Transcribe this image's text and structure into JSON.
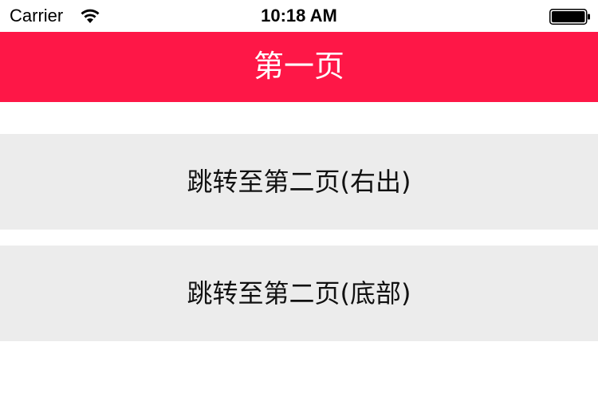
{
  "status_bar": {
    "carrier": "Carrier",
    "time": "10:18 AM",
    "wifi_icon": "wifi-icon",
    "battery_icon": "battery-icon"
  },
  "nav": {
    "title": "第一页",
    "color": "#fe1747"
  },
  "buttons": [
    {
      "label": "跳转至第二页(右出)"
    },
    {
      "label": "跳转至第二页(底部)"
    }
  ],
  "colors": {
    "button_bg": "#ececec",
    "background": "#ffffff"
  }
}
